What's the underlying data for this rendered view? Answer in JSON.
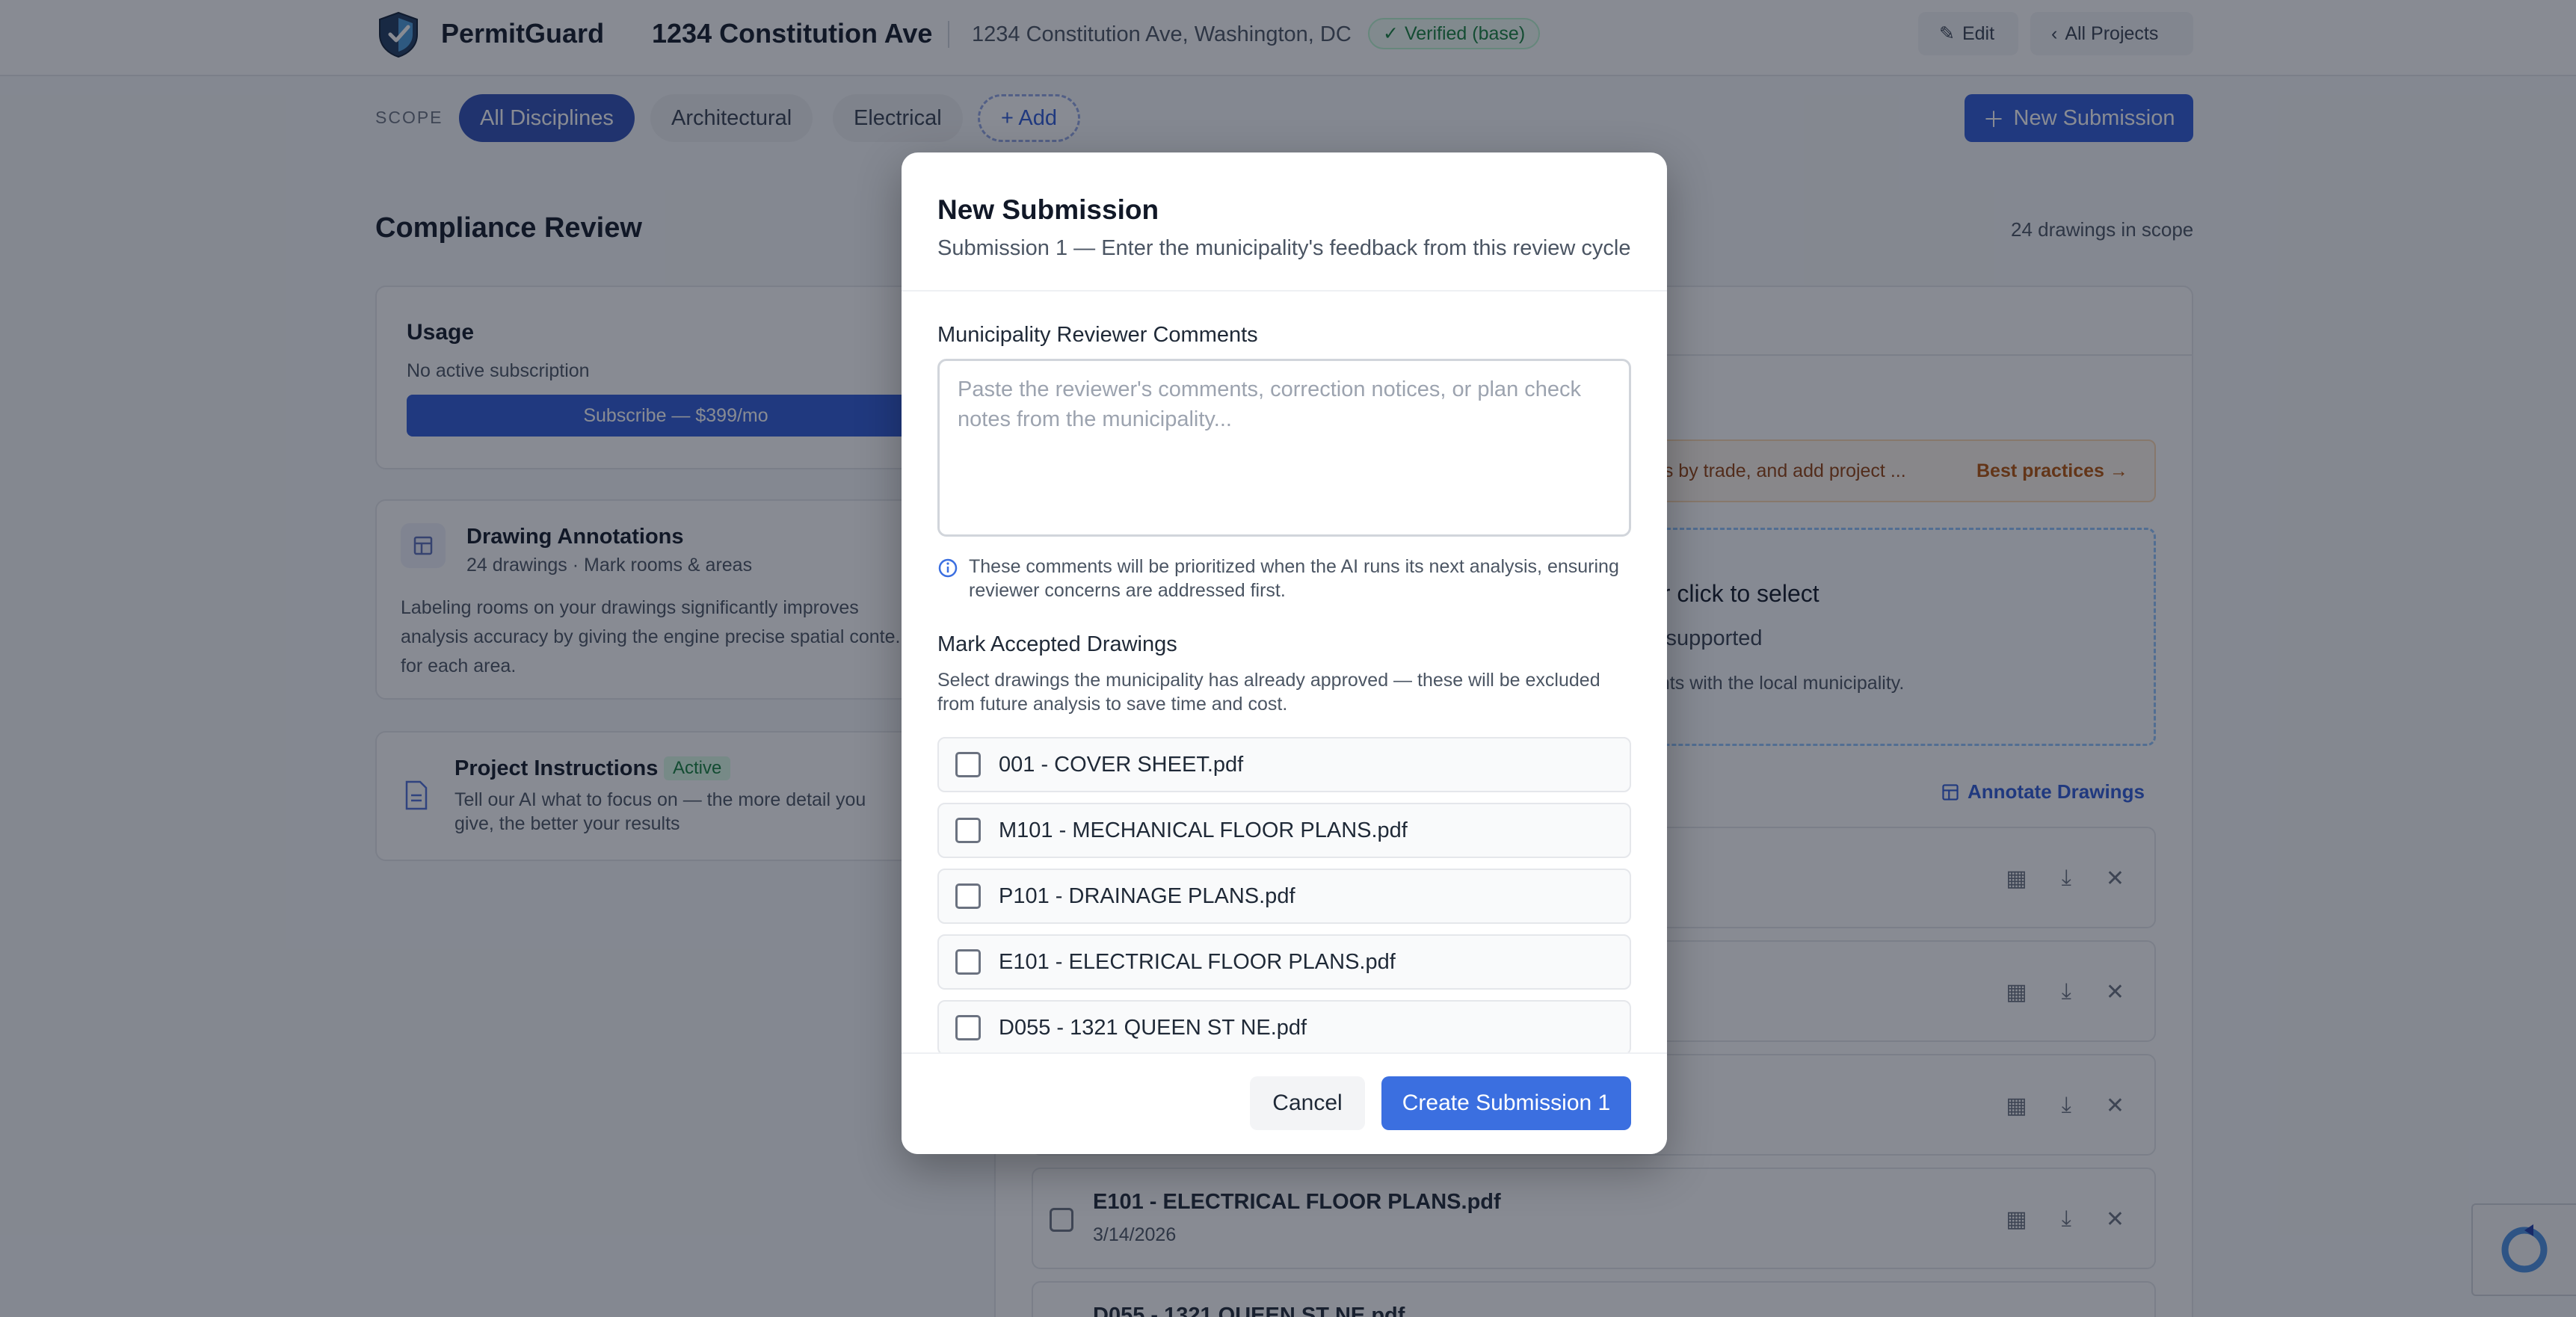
{
  "header": {
    "brand": "PermitGuard",
    "project_title": "1234 Constitution Ave",
    "project_address": "1234 Constitution Ave, Washington, DC",
    "verified_badge": "Verified (base)",
    "edit_label": "Edit",
    "all_projects_label": "All Projects"
  },
  "scope": {
    "label": "SCOPE",
    "chips": [
      "All Disciplines",
      "Architectural",
      "Electrical"
    ],
    "add_label": "+ Add",
    "new_submission_label": "New Submission"
  },
  "main": {
    "title": "Compliance Review",
    "drawings_count": "24 drawings in scope",
    "usage": {
      "title": "Usage",
      "status": "No active subscription",
      "subscribe_label": "Subscribe — $399/mo"
    },
    "annotations": {
      "title": "Drawing Annotations",
      "meta": "24 drawings · Mark rooms & areas",
      "description": "Labeling rooms on your drawings significantly improves analysis accuracy by giving the engine precise spatial conte... for each area."
    },
    "instructions": {
      "title": "Project Instructions",
      "badge": "Active",
      "description": "Tell our AI what to focus on — the more detail you give, the better your results"
    }
  },
  "right": {
    "tip_text": "t files by trade, and add project ...",
    "tip_link": "Best practices →",
    "dropzone_line1": "or click to select",
    "dropzone_line2": "s supported",
    "dropzone_line3": "ents with the local municipality.",
    "annotate_label": "Annotate Drawings",
    "visible_row_name": "E101 - ELECTRICAL FLOOR PLANS.pdf",
    "visible_row_date": "3/14/2026",
    "partial_row_name": "D055 - 1321 QUEEN ST NE.pdf"
  },
  "modal": {
    "title": "New Submission",
    "subtitle": "Submission 1 — Enter the municipality's feedback from this review cycle",
    "comments_label": "Municipality Reviewer Comments",
    "comments_placeholder": "Paste the reviewer's comments, correction notices, or plan check notes from the municipality...",
    "comments_value": "",
    "info_text": "These comments will be prioritized when the AI runs its next analysis, ensuring reviewer concerns are addressed first.",
    "accepted_label": "Mark Accepted Drawings",
    "accepted_desc": "Select drawings the municipality has already approved — these will be excluded from future analysis to save time and cost.",
    "files": [
      "001 - COVER SHEET.pdf",
      "M101 - MECHANICAL FLOOR PLANS.pdf",
      "P101 - DRAINAGE PLANS.pdf",
      "E101 - ELECTRICAL FLOOR PLANS.pdf",
      "D055 - 1321 QUEEN ST NE.pdf"
    ],
    "cancel_label": "Cancel",
    "create_label": "Create Submission 1"
  },
  "colors": {
    "primary": "#2f5bd7",
    "verified_green": "#15803d",
    "overlay": "rgba(17,24,39,0.5)"
  }
}
